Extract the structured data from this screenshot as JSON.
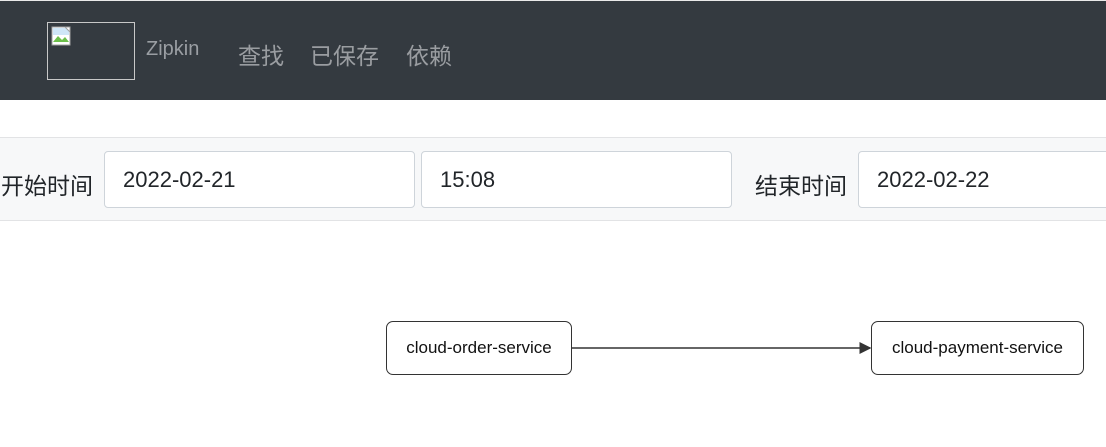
{
  "navbar": {
    "brand": "Zipkin",
    "links": [
      "查找",
      "已保存",
      "依赖"
    ]
  },
  "search": {
    "start_label": "开始时间",
    "start_date": "2022-02-21",
    "start_time": "15:08",
    "end_label": "结束时间",
    "end_date": "2022-02-22"
  },
  "graph": {
    "nodes": [
      "cloud-order-service",
      "cloud-payment-service"
    ],
    "edges": [
      {
        "from": "cloud-order-service",
        "to": "cloud-payment-service"
      }
    ]
  },
  "colors": {
    "navbar_bg": "#343a40",
    "search_bg": "#f7f8f9",
    "node_border": "#333333"
  },
  "icons": {
    "logo": "broken-image-icon"
  }
}
